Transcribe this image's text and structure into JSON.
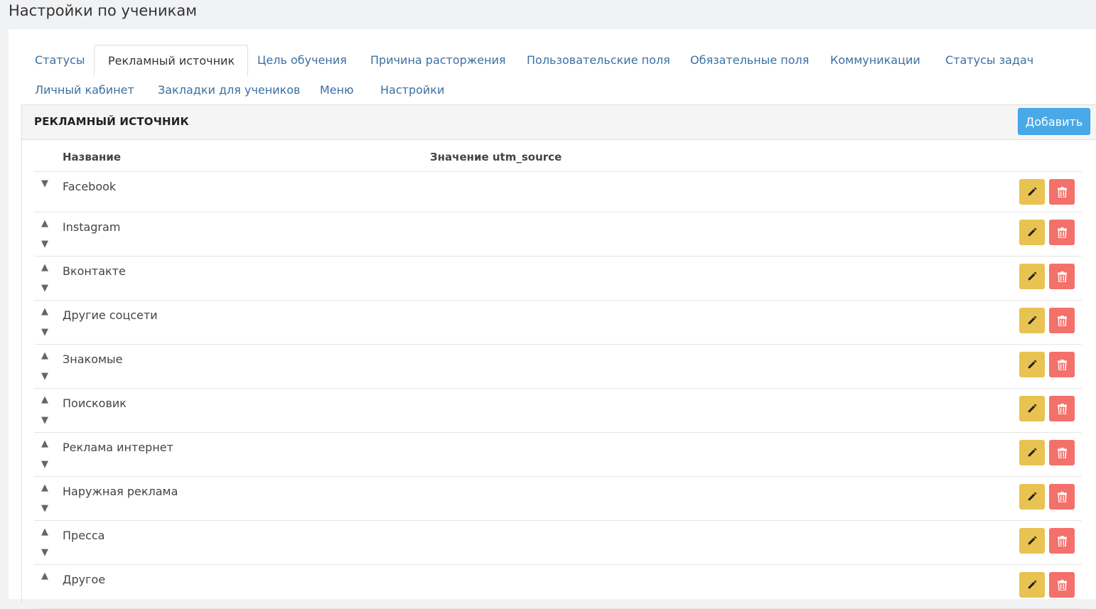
{
  "page": {
    "title": "Настройки по ученикам"
  },
  "tabs": [
    {
      "label": "Статусы"
    },
    {
      "label": "Рекламный источник"
    },
    {
      "label": "Цель обучения"
    },
    {
      "label": "Причина расторжения"
    },
    {
      "label": "Пользовательские поля"
    },
    {
      "label": "Обязательные поля"
    },
    {
      "label": "Коммуникации"
    },
    {
      "label": "Статусы задач"
    },
    {
      "label": "Личный кабинет"
    },
    {
      "label": "Закладки для учеников"
    },
    {
      "label": "Меню"
    },
    {
      "label": "Настройки"
    }
  ],
  "active_tab": "Рекламный источник",
  "panel": {
    "title": "РЕКЛАМНЫЙ ИСТОЧНИК",
    "add_label": "Добавить",
    "columns": {
      "name": "Название",
      "utm": "Значение utm_source"
    }
  },
  "rows": [
    {
      "name": "Facebook",
      "utm": ""
    },
    {
      "name": "Instagram",
      "utm": ""
    },
    {
      "name": "Вконтакте",
      "utm": ""
    },
    {
      "name": "Другие соцсети",
      "utm": ""
    },
    {
      "name": "Знакомые",
      "utm": ""
    },
    {
      "name": "Поисковик",
      "utm": ""
    },
    {
      "name": "Реклама интернет",
      "utm": ""
    },
    {
      "name": "Наружная реклама",
      "utm": ""
    },
    {
      "name": "Пресса",
      "utm": ""
    },
    {
      "name": "Другое",
      "utm": ""
    }
  ],
  "icons": {
    "move_up": "triangle-up-icon",
    "move_down": "triangle-down-icon",
    "edit": "pencil-icon",
    "delete": "trash-icon"
  },
  "colors": {
    "link": "#3b6fa3",
    "add_button": "#49a9e8",
    "edit_button": "#e8c352",
    "delete_button": "#f4706a"
  }
}
